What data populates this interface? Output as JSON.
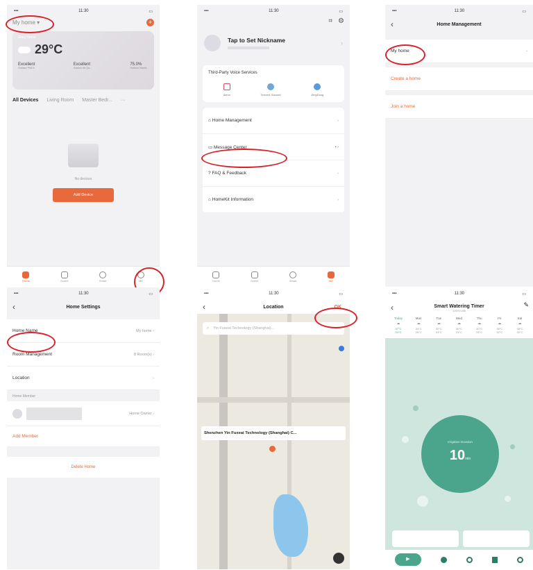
{
  "p1": {
    "time": "11:30",
    "home_selector": "My home",
    "weather_place": "Grey Home",
    "temperature": "29°C",
    "stats": [
      {
        "value": "Excellent",
        "label": "Outdoor PM2.5"
      },
      {
        "value": "Excellent",
        "label": "Outdoor Air Qu..."
      },
      {
        "value": "75.0%",
        "label": "Outdoor Humid..."
      }
    ],
    "rooms": [
      "All Devices",
      "Living Room",
      "Master Bedr..."
    ],
    "empty_text": "No devices",
    "add_button": "Add Device",
    "tabs": [
      "Home",
      "Scene",
      "Smart",
      "Me"
    ]
  },
  "p2": {
    "nickname": "Tap to Set Nickname",
    "voice_title": "Third-Party Voice Services",
    "voice_services": [
      "Alexa",
      "Tencent Xiaowei",
      "DingDong"
    ],
    "menu": [
      "Home Management",
      "Message Center",
      "FAQ & Feedback",
      "HomeKit Information"
    ],
    "tabs": [
      "Home",
      "Scene",
      "Smart",
      "Me"
    ]
  },
  "p3": {
    "title": "Home Management",
    "home": "My home",
    "create": "Create a home",
    "join": "Join a home"
  },
  "p4": {
    "title": "Home Settings",
    "rows": [
      {
        "label": "Home Name",
        "value": "My home"
      },
      {
        "label": "Room Management",
        "value": "8 Room(s)"
      },
      {
        "label": "Location",
        "value": ""
      }
    ],
    "member_header": "Home Member",
    "member_role": "Home Owner",
    "add_member": "Add Member",
    "delete": "Delete Home"
  },
  "p5": {
    "title": "Location",
    "ok": "OK",
    "search": "Yin Fuxeai Technology (Shanghai)...",
    "pin_label": "Shenzhen Yin Fuxeai Technology (Shanghai) C..."
  },
  "p6": {
    "title": "Smart Watering Timer",
    "subtitle": "100%  Link",
    "days": [
      "Today",
      "Mon",
      "Tue",
      "Wed",
      "Thu",
      "Fri",
      "Sat"
    ],
    "highs": [
      "37°C",
      "34°C",
      "30°C",
      "30°C",
      "30°C",
      "38°C",
      "38°C"
    ],
    "lows": [
      "24°C",
      "25°C",
      "24°C",
      "24°C",
      "25°C",
      "32°C",
      "32°C"
    ],
    "circle_caption": "Irrigation Duration",
    "value": "10",
    "unit": "min"
  },
  "colors": {
    "accent": "#e86a3c",
    "highlight": "#d8222a",
    "teal": "#4aa58c"
  }
}
